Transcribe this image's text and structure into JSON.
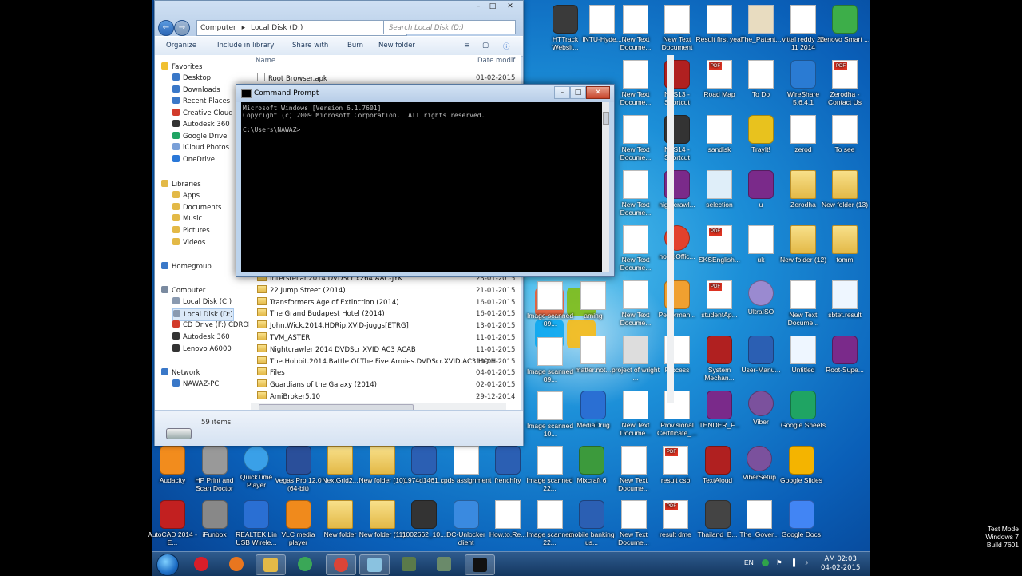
{
  "desktop": {
    "icons_right": [
      {
        "label": "HTTrack Websit...",
        "glyph": "app",
        "color": "#3a3a3a"
      },
      {
        "label": "INTU-Hyde...",
        "glyph": "doc",
        "color": "#ffffff"
      },
      {
        "label": "New Text Docume...",
        "glyph": "doc",
        "color": "#ffffff"
      },
      {
        "label": "New Text Document",
        "glyph": "doc",
        "color": "#ffffff"
      },
      {
        "label": "Result first year",
        "glyph": "doc",
        "color": "#ffffff"
      },
      {
        "label": "The_Patent...",
        "glyph": "doc",
        "color": "#e8dcc0"
      },
      {
        "label": "vittal reddy 23 11 2014",
        "glyph": "doc",
        "color": "#ffffff"
      },
      {
        "label": "Lenovo Smart ...",
        "glyph": "app",
        "color": "#3dae49"
      },
      {
        "label": "New Text Docume...",
        "glyph": "doc",
        "color": "#ffffff"
      },
      {
        "label": "NFS13 - Shortcut",
        "glyph": "app",
        "color": "#b02020"
      },
      {
        "label": "Road Map",
        "glyph": "pdf",
        "color": "#ffffff"
      },
      {
        "label": "To Do",
        "glyph": "doc",
        "color": "#ffffff"
      },
      {
        "label": "WireShare 5.6.4.1",
        "glyph": "app",
        "color": "#2a7bd3"
      },
      {
        "label": "Zerodha - Contact Us",
        "glyph": "pdf",
        "color": "#ffffff"
      },
      {
        "label": "New Text Docume...",
        "glyph": "doc",
        "color": "#ffffff"
      },
      {
        "label": "NFS14 - Shortcut",
        "glyph": "app",
        "color": "#333333"
      },
      {
        "label": "sandisk",
        "glyph": "doc",
        "color": "#ffffff"
      },
      {
        "label": "TrayIt!",
        "glyph": "app",
        "color": "#e8c21e"
      },
      {
        "label": "zerod",
        "glyph": "doc",
        "color": "#ffffff"
      },
      {
        "label": "To see",
        "glyph": "doc",
        "color": "#ffffff"
      },
      {
        "label": "New Text Docume...",
        "glyph": "doc",
        "color": "#ffffff"
      },
      {
        "label": "nightcrawl...",
        "glyph": "app",
        "color": "#7a2a8a"
      },
      {
        "label": "selection",
        "glyph": "doc",
        "color": "#dfeef9"
      },
      {
        "label": "u",
        "glyph": "app",
        "color": "#7a2a8a"
      },
      {
        "label": "Zerodha",
        "glyph": "folder",
        "color": "#e3b947"
      },
      {
        "label": "New folder (13)",
        "glyph": "folder",
        "color": "#e3b947"
      },
      {
        "label": "New Text Docume...",
        "glyph": "doc",
        "color": "#ffffff"
      },
      {
        "label": "nodalOffic...",
        "glyph": "circle",
        "color": "#e2412d"
      },
      {
        "label": "SKSEnglish...",
        "glyph": "pdf",
        "color": "#ffffff"
      },
      {
        "label": "uk",
        "glyph": "doc",
        "color": "#ffffff"
      },
      {
        "label": "New folder (12)",
        "glyph": "folder",
        "color": "#e3b947"
      },
      {
        "label": "tomm",
        "glyph": "folder",
        "color": "#e3b947"
      },
      {
        "label": "New Text Docume...",
        "glyph": "doc",
        "color": "#ffffff"
      },
      {
        "label": "Performan...",
        "glyph": "app",
        "color": "#f0a030"
      },
      {
        "label": "studentAp...",
        "glyph": "pdf",
        "color": "#ffffff"
      },
      {
        "label": "UltraISO",
        "glyph": "circle",
        "color": "#9a8ad0"
      },
      {
        "label": "New Text Docume...",
        "glyph": "doc",
        "color": "#ffffff"
      },
      {
        "label": "sbtet.result",
        "glyph": "doc",
        "color": "#eef6ff"
      },
      {
        "label": "matter.not...",
        "glyph": "doc",
        "color": "#ffffff"
      },
      {
        "label": "project of wright ...",
        "glyph": "doc",
        "color": "#dddddd"
      },
      {
        "label": "Process",
        "glyph": "doc",
        "color": "#ffffff"
      },
      {
        "label": "System Mechan...",
        "glyph": "app",
        "color": "#b02020"
      },
      {
        "label": "User-Manu...",
        "glyph": "app",
        "color": "#2b5fb3"
      },
      {
        "label": "Untitled",
        "glyph": "doc",
        "color": "#eef6ff"
      },
      {
        "label": "Root-Supe...",
        "glyph": "app",
        "color": "#7a2a8a"
      },
      {
        "label": "MediaDrug",
        "glyph": "app",
        "color": "#2a6fd3"
      },
      {
        "label": "New Text Docume...",
        "glyph": "doc",
        "color": "#ffffff"
      },
      {
        "label": "Provisional Certificate_...",
        "glyph": "doc",
        "color": "#ffffff"
      },
      {
        "label": "TENDER_F...",
        "glyph": "app",
        "color": "#7a2a8a"
      },
      {
        "label": "Viber",
        "glyph": "circle",
        "color": "#7b519d"
      },
      {
        "label": "Google Sheets",
        "glyph": "app",
        "color": "#1fa463"
      }
    ],
    "icons_bottom": [
      {
        "label": "Audacity",
        "glyph": "app",
        "color": "#f28c1d"
      },
      {
        "label": "HP Print and Scan Doctor",
        "glyph": "app",
        "color": "#999999"
      },
      {
        "label": "QuickTime Player",
        "glyph": "circle",
        "color": "#3aa0e8"
      },
      {
        "label": "Vegas Pro 12.0 (64-bit)",
        "glyph": "app",
        "color": "#2a4f9a"
      },
      {
        "label": "NextGrid2...",
        "glyph": "folder",
        "color": "#e3b947"
      },
      {
        "label": "New folder (10)",
        "glyph": "folder",
        "color": "#e3b947"
      },
      {
        "label": "1974d1461...",
        "glyph": "app",
        "color": "#2b5fb3"
      },
      {
        "label": "cpds assignment",
        "glyph": "doc",
        "color": "#ffffff"
      },
      {
        "label": "frenchfry",
        "glyph": "app",
        "color": "#2b5fb3"
      },
      {
        "label": "Image scanned 22...",
        "glyph": "doc",
        "color": "#ffffff"
      },
      {
        "label": "Mixcraft 6",
        "glyph": "app",
        "color": "#3c9a3c"
      },
      {
        "label": "New Text Docume...",
        "glyph": "doc",
        "color": "#ffffff"
      },
      {
        "label": "result csb",
        "glyph": "pdf",
        "color": "#ffffff"
      },
      {
        "label": "TextAloud",
        "glyph": "app",
        "color": "#b02020"
      },
      {
        "label": "ViberSetup",
        "glyph": "circle",
        "color": "#7b519d"
      },
      {
        "label": "Google Slides",
        "glyph": "app",
        "color": "#f4b400"
      },
      {
        "label": "AutoCAD 2014 - E...",
        "glyph": "app",
        "color": "#c22020"
      },
      {
        "label": "iFunbox",
        "glyph": "app",
        "color": "#888888"
      },
      {
        "label": "REALTEK Lin USB Wirele...",
        "glyph": "app",
        "color": "#2a6fd3"
      },
      {
        "label": "VLC media player",
        "glyph": "app",
        "color": "#f08a1c"
      },
      {
        "label": "New folder",
        "glyph": "folder",
        "color": "#e3b947"
      },
      {
        "label": "New folder (11)",
        "glyph": "folder",
        "color": "#e3b947"
      },
      {
        "label": "1002662_10...",
        "glyph": "app",
        "color": "#333333"
      },
      {
        "label": "DC-Unlocker client",
        "glyph": "app",
        "color": "#3a8ae0"
      },
      {
        "label": "How.to.Re...",
        "glyph": "doc",
        "color": "#ffffff"
      },
      {
        "label": "Image scanned 22...",
        "glyph": "doc",
        "color": "#ffffff"
      },
      {
        "label": "mobile banking us...",
        "glyph": "app",
        "color": "#2b5fb3"
      },
      {
        "label": "New Text Docume...",
        "glyph": "doc",
        "color": "#ffffff"
      },
      {
        "label": "result dme",
        "glyph": "pdf",
        "color": "#ffffff"
      },
      {
        "label": "Thailand_B...",
        "glyph": "app",
        "color": "#444444"
      },
      {
        "label": "The_Gover...",
        "glyph": "doc",
        "color": "#ffffff"
      },
      {
        "label": "Google Docs",
        "glyph": "app",
        "color": "#4285f4"
      }
    ],
    "icons_partial": [
      {
        "label": "Image scanned 09...",
        "glyph": "doc",
        "color": "#ffffff"
      },
      {
        "label": "Image scanned 09...",
        "glyph": "doc",
        "color": "#ffffff"
      },
      {
        "label": "Image scanned 10...",
        "glyph": "doc",
        "color": "#ffffff"
      },
      {
        "label": "aming",
        "glyph": "doc",
        "color": "#ffffff"
      }
    ]
  },
  "explorer": {
    "breadcrumb": [
      "Computer",
      "Local Disk (D:)"
    ],
    "search_placeholder": "Search Local Disk (D:)",
    "toolbar": [
      "Organize",
      "Include in library",
      "Share with",
      "Burn",
      "New folder"
    ],
    "nav": [
      {
        "label": "Favorites",
        "head": true,
        "color": "#f0c030"
      },
      {
        "label": "Desktop",
        "color": "#3a78c8"
      },
      {
        "label": "Downloads",
        "color": "#3a78c8"
      },
      {
        "label": "Recent Places",
        "color": "#3a78c8"
      },
      {
        "label": "Creative Cloud Fi",
        "color": "#d23b2b"
      },
      {
        "label": "Autodesk 360",
        "color": "#333333"
      },
      {
        "label": "Google Drive",
        "color": "#1fa463"
      },
      {
        "label": "iCloud Photos",
        "color": "#7aa0d8"
      },
      {
        "label": "OneDrive",
        "color": "#2a78d8"
      },
      {
        "label": "Libraries",
        "head": true,
        "color": "#e3b947"
      },
      {
        "label": "Apps",
        "color": "#e3b947"
      },
      {
        "label": "Documents",
        "color": "#e3b947"
      },
      {
        "label": "Music",
        "color": "#e3b947"
      },
      {
        "label": "Pictures",
        "color": "#e3b947"
      },
      {
        "label": "Videos",
        "color": "#e3b947"
      },
      {
        "label": "Homegroup",
        "head": true,
        "color": "#3a78c8"
      },
      {
        "label": "Computer",
        "head": true,
        "color": "#7a8aa0"
      },
      {
        "label": "Local Disk (C:)",
        "color": "#8a9ab0"
      },
      {
        "label": "Local Disk (D:)",
        "color": "#8a9ab0",
        "selected": true
      },
      {
        "label": "CD Drive (F:) CDROM",
        "color": "#d23b2b"
      },
      {
        "label": "Autodesk 360",
        "color": "#333333"
      },
      {
        "label": "Lenovo A6000",
        "color": "#333333"
      },
      {
        "label": "Network",
        "head": true,
        "color": "#3a78c8"
      },
      {
        "label": "NAWAZ-PC",
        "color": "#3a78c8"
      }
    ],
    "columns": {
      "name": "Name",
      "date": "Date modif"
    },
    "files_top": [
      {
        "name": "Root Browser.apk",
        "date": "01-02-2015"
      }
    ],
    "files": [
      {
        "name": "Interstellar.2014 DVDScr x264 AAC-JYK",
        "date": "23-01-2015"
      },
      {
        "name": "22 Jump Street (2014)",
        "date": "21-01-2015"
      },
      {
        "name": "Transformers Age of Extinction (2014)",
        "date": "16-01-2015"
      },
      {
        "name": "The Grand Budapest Hotel (2014)",
        "date": "16-01-2015"
      },
      {
        "name": "John.Wick.2014.HDRip.XViD-juggs[ETRG]",
        "date": "13-01-2015"
      },
      {
        "name": "TVM_ASTER",
        "date": "11-01-2015"
      },
      {
        "name": "Nightcrawler 2014 DVDScr XVID AC3 ACAB",
        "date": "11-01-2015"
      },
      {
        "name": "The.Hobbit.2014.Battle.Of.The.Five.Armies.DVDScr.XVID.AC3.HQ.H...",
        "date": "10-01-2015"
      },
      {
        "name": "Files",
        "date": "04-01-2015"
      },
      {
        "name": "Guardians of the Galaxy (2014)",
        "date": "02-01-2015"
      },
      {
        "name": "AmiBroker5.10",
        "date": "29-12-2014"
      }
    ],
    "status": "59 items"
  },
  "cmd": {
    "title": "Command Prompt",
    "lines": "Microsoft Windows [Version 6.1.7601]\nCopyright (c) 2009 Microsoft Corporation.  All rights reserved.\n\nC:\\Users\\NAWAZ>",
    "icon": "cmd-icon"
  },
  "taskbar": {
    "apps": [
      {
        "name": "opera",
        "color": "#d81e2a",
        "active": false
      },
      {
        "name": "firefox",
        "color": "#e8761f",
        "active": false
      },
      {
        "name": "explorer",
        "color": "#e3b947",
        "active": true
      },
      {
        "name": "chrome",
        "color": "#3aa757",
        "active": false
      },
      {
        "name": "chrome",
        "color": "#db4437",
        "active": true
      },
      {
        "name": "photo",
        "color": "#8ac2e0",
        "active": true
      },
      {
        "name": "vm",
        "color": "#5a7a4a",
        "active": false
      },
      {
        "name": "tools",
        "color": "#6a8a6a",
        "active": false
      },
      {
        "name": "cmd",
        "color": "#111111",
        "active": true
      }
    ],
    "lang": "EN",
    "time": "AM 02:03",
    "date": "04-02-2015"
  },
  "watermark": [
    "Test Mode",
    "Windows 7",
    "Build 7601"
  ]
}
